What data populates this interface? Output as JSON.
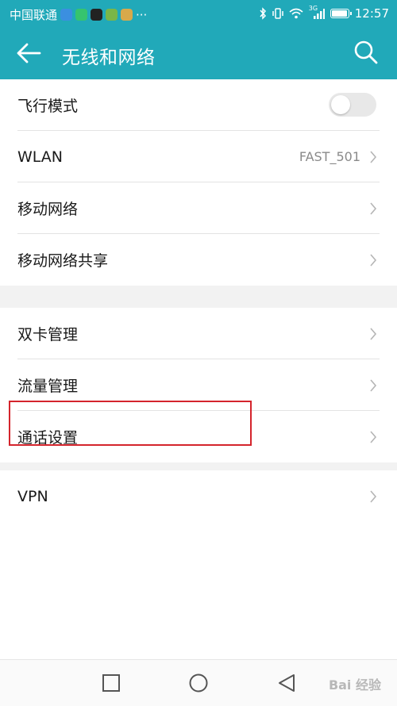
{
  "status_bar": {
    "carrier": "中国联通",
    "more": "···",
    "network_tag": "3G",
    "time": "12:57"
  },
  "app_bar": {
    "title": "无线和网络"
  },
  "groups": [
    [
      {
        "label": "飞行模式",
        "control": "toggle",
        "toggle_on": false
      },
      {
        "label": "WLAN",
        "value": "FAST_501"
      },
      {
        "label": "移动网络"
      },
      {
        "label": "移动网络共享"
      }
    ],
    [
      {
        "label": "双卡管理"
      },
      {
        "label": "流量管理"
      },
      {
        "label": "通话设置"
      }
    ],
    [
      {
        "label": "VPN"
      }
    ]
  ],
  "watermark": "Bai 经验",
  "colors": {
    "header": "#21a9b9",
    "highlight_box": "#d4242c"
  }
}
